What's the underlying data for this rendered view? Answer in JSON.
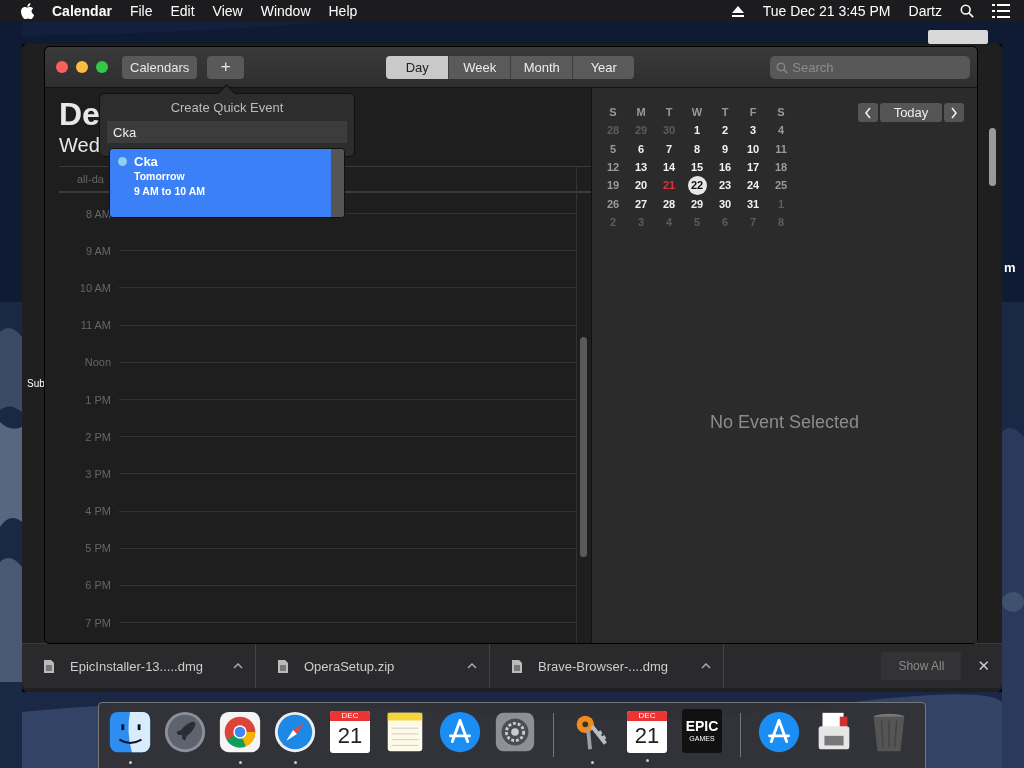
{
  "menubar": {
    "app": "Calendar",
    "menus": [
      "File",
      "Edit",
      "View",
      "Window",
      "Help"
    ],
    "clock": "Tue Dec 21  3:45 PM",
    "user": "Dartz"
  },
  "desktop_fragments": [
    {
      "text": "Sub",
      "kind": "page"
    },
    {
      "text": "m",
      "kind": "desktop"
    }
  ],
  "calendar_window": {
    "toolbar": {
      "calendars_button": "Calendars",
      "add_button": "+",
      "views": [
        {
          "label": "Day",
          "selected": true
        },
        {
          "label": "Week",
          "selected": false
        },
        {
          "label": "Month",
          "selected": false
        },
        {
          "label": "Year",
          "selected": false
        }
      ],
      "search": {
        "placeholder": "Search"
      }
    },
    "day_view": {
      "title": "De",
      "weekday": "Wed",
      "all_day_label": "all-da",
      "hours": [
        "8 AM",
        "9 AM",
        "10 AM",
        "11 AM",
        "Noon",
        "1 PM",
        "2 PM",
        "3 PM",
        "4 PM",
        "5 PM",
        "6 PM",
        "7 PM"
      ]
    },
    "quick_event": {
      "title": "Create Quick Event",
      "value": "Cka",
      "suggestion": {
        "name": "Cka",
        "day": "Tomorrow",
        "time": "9 AM to 10 AM",
        "selected": true
      }
    },
    "mini_calendar": {
      "weekdays": [
        "S",
        "M",
        "T",
        "W",
        "T",
        "F",
        "S"
      ],
      "today_button": "Today",
      "days": [
        {
          "label": "28",
          "kind": "outside",
          "selected": false
        },
        {
          "label": "29",
          "kind": "outside",
          "selected": false
        },
        {
          "label": "30",
          "kind": "outside",
          "selected": false
        },
        {
          "label": "1",
          "kind": "weekday",
          "selected": false
        },
        {
          "label": "2",
          "kind": "weekday",
          "selected": false
        },
        {
          "label": "3",
          "kind": "weekday",
          "selected": false
        },
        {
          "label": "4",
          "kind": "weekend",
          "selected": false
        },
        {
          "label": "5",
          "kind": "weekend",
          "selected": false
        },
        {
          "label": "6",
          "kind": "weekday",
          "selected": false
        },
        {
          "label": "7",
          "kind": "weekday",
          "selected": false
        },
        {
          "label": "8",
          "kind": "weekday",
          "selected": false
        },
        {
          "label": "9",
          "kind": "weekday",
          "selected": false
        },
        {
          "label": "10",
          "kind": "weekday",
          "selected": false
        },
        {
          "label": "11",
          "kind": "weekend",
          "selected": false
        },
        {
          "label": "12",
          "kind": "weekend",
          "selected": false
        },
        {
          "label": "13",
          "kind": "weekday",
          "selected": false
        },
        {
          "label": "14",
          "kind": "weekday",
          "selected": false
        },
        {
          "label": "15",
          "kind": "weekday",
          "selected": false
        },
        {
          "label": "16",
          "kind": "weekday",
          "selected": false
        },
        {
          "label": "17",
          "kind": "weekday",
          "selected": false
        },
        {
          "label": "18",
          "kind": "weekend",
          "selected": false
        },
        {
          "label": "19",
          "kind": "weekend",
          "selected": false
        },
        {
          "label": "20",
          "kind": "weekday",
          "selected": false
        },
        {
          "label": "21",
          "kind": "today",
          "selected": false
        },
        {
          "label": "22",
          "kind": "weekday",
          "selected": true
        },
        {
          "label": "23",
          "kind": "weekday",
          "selected": false
        },
        {
          "label": "24",
          "kind": "weekday",
          "selected": false
        },
        {
          "label": "25",
          "kind": "weekend",
          "selected": false
        },
        {
          "label": "26",
          "kind": "weekend",
          "selected": false
        },
        {
          "label": "27",
          "kind": "weekday",
          "selected": false
        },
        {
          "label": "28",
          "kind": "weekday",
          "selected": false
        },
        {
          "label": "29",
          "kind": "weekday",
          "selected": false
        },
        {
          "label": "30",
          "kind": "weekday",
          "selected": false
        },
        {
          "label": "31",
          "kind": "weekday",
          "selected": false
        },
        {
          "label": "1",
          "kind": "outside",
          "selected": false
        },
        {
          "label": "2",
          "kind": "outside",
          "selected": false
        },
        {
          "label": "3",
          "kind": "outside",
          "selected": false
        },
        {
          "label": "4",
          "kind": "outside",
          "selected": false
        },
        {
          "label": "5",
          "kind": "outside",
          "selected": false
        },
        {
          "label": "6",
          "kind": "outside",
          "selected": false
        },
        {
          "label": "7",
          "kind": "outside",
          "selected": false
        },
        {
          "label": "8",
          "kind": "outside",
          "selected": false
        }
      ]
    },
    "detail": "No Event Selected"
  },
  "downloads": {
    "items": [
      {
        "name": "EpicInstaller-13.....dmg"
      },
      {
        "name": "OperaSetup.zip"
      },
      {
        "name": "Brave-Browser-....dmg"
      }
    ],
    "show_all": "Show All",
    "close": "✕"
  },
  "dock": {
    "sections": [
      [
        {
          "kind": "finder",
          "running": true
        },
        {
          "kind": "launchpad",
          "running": false
        },
        {
          "kind": "chrome",
          "running": true
        },
        {
          "kind": "safari",
          "running": true
        },
        {
          "kind": "calendar",
          "month": "DEC",
          "date": "21",
          "running": false
        },
        {
          "kind": "notes",
          "running": false
        },
        {
          "kind": "appstore",
          "running": false
        },
        {
          "kind": "settings",
          "running": false
        }
      ],
      [
        {
          "kind": "keychain",
          "running": true
        },
        {
          "kind": "calendar",
          "month": "DEC",
          "date": "21",
          "running": true
        },
        {
          "kind": "epic",
          "lines": [
            "EPIC",
            "GAMES"
          ],
          "running": false
        }
      ],
      [
        {
          "kind": "appstore",
          "running": false
        },
        {
          "kind": "printer",
          "running": false
        },
        {
          "kind": "trash",
          "running": false
        }
      ]
    ]
  }
}
